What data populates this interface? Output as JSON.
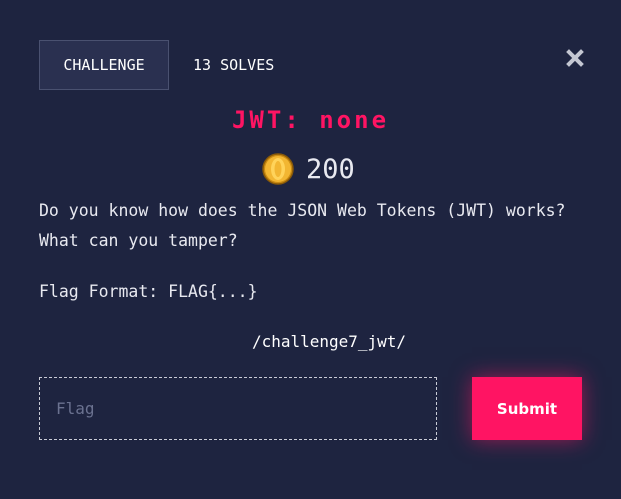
{
  "tabs": {
    "challenge_label": "CHALLENGE",
    "solves_label": "13 SOLVES"
  },
  "close_icon": "close-icon",
  "challenge": {
    "title": "JWT: none",
    "points": "200",
    "coin_icon": "coin-icon",
    "description_line1": "Do you know how does the JSON Web Tokens (JWT) works?",
    "description_line2": "What can you tamper?",
    "flag_format": "Flag Format: FLAG{...}",
    "link": "/challenge7_jwt/"
  },
  "form": {
    "flag_placeholder": "Flag",
    "flag_value": "",
    "submit_label": "Submit"
  },
  "colors": {
    "background": "#1e2440",
    "accent": "#ff1463",
    "coin": "#f2b632",
    "text": "#e8e9f0"
  }
}
